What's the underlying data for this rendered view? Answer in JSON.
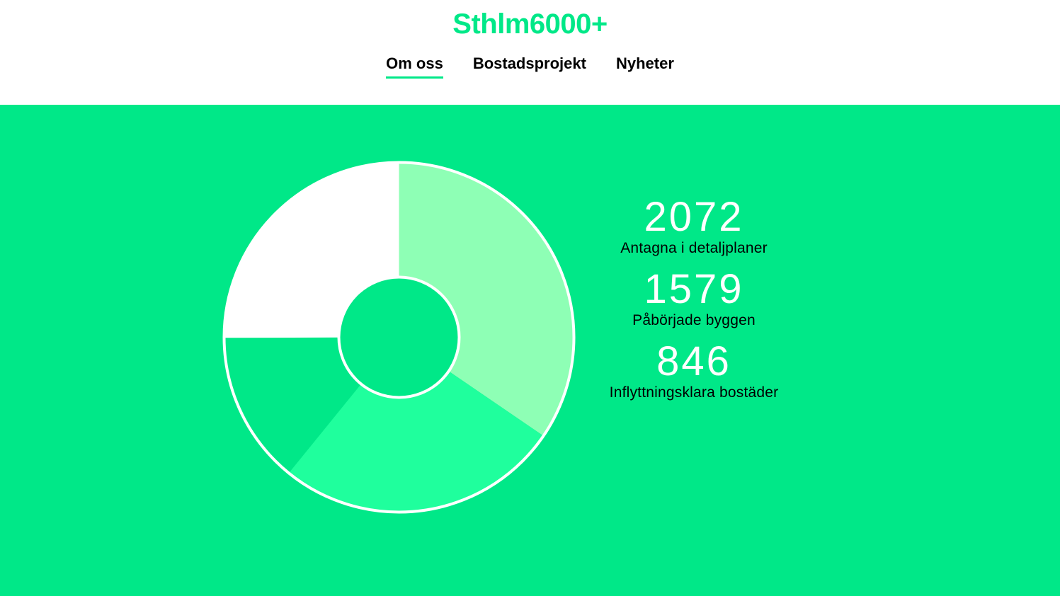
{
  "header": {
    "logo": "Sthlm6000+",
    "nav": [
      {
        "label": "Om oss",
        "active": true
      },
      {
        "label": "Bostadsprojekt",
        "active": false
      },
      {
        "label": "Nyheter",
        "active": false
      }
    ]
  },
  "colors": {
    "brand": "#00e888",
    "background_hero": "#00e888",
    "slice_light": "#8effb5",
    "slice_mid": "#1fff9d",
    "slice_base": "#00e888",
    "slice_white": "#ffffff"
  },
  "stats": [
    {
      "value": "2072",
      "label": "Antagna i detaljplaner"
    },
    {
      "value": "1579",
      "label": "Påbörjade byggen"
    },
    {
      "value": "846",
      "label": "Inflyttningsklara bostäder"
    }
  ],
  "chart_data": {
    "type": "pie",
    "categories": [
      "Antagna i detaljplaner",
      "Påbörjade byggen",
      "Inflyttningsklara bostäder",
      ""
    ],
    "values": [
      2072,
      1579,
      846,
      1503
    ],
    "total": 6000
  }
}
